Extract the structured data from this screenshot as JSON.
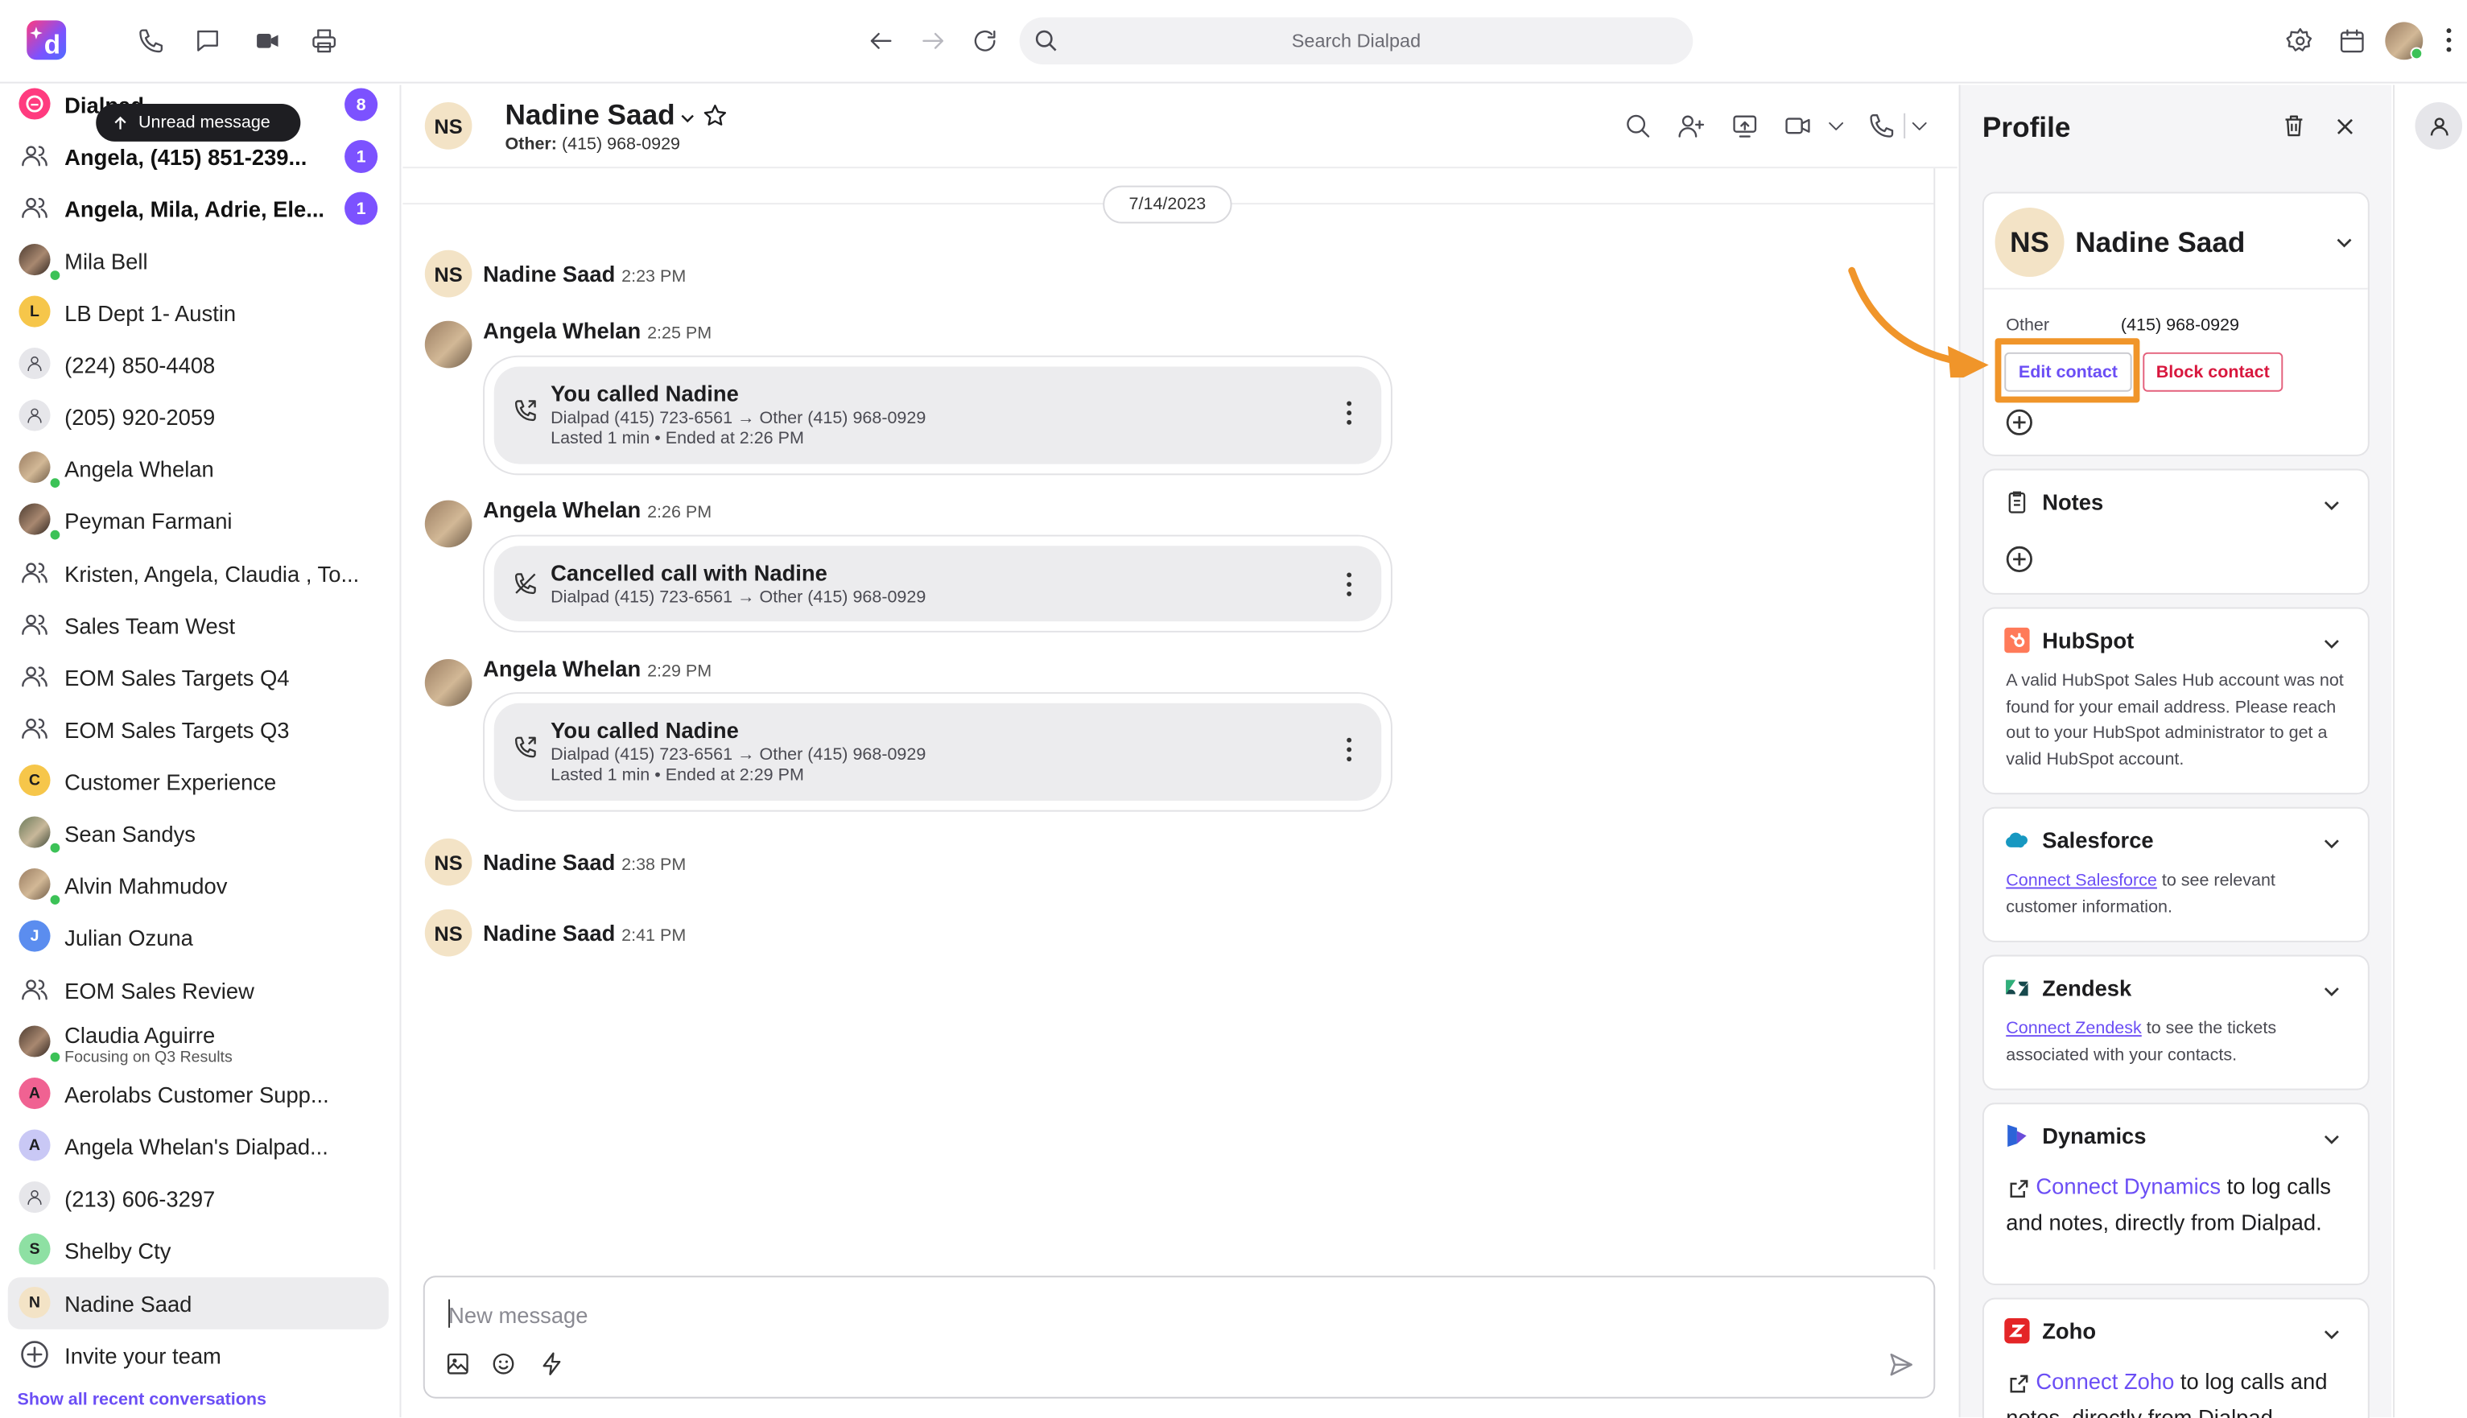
{
  "topbar": {
    "search_placeholder": "Search Dialpad"
  },
  "tooltip": {
    "text": "Unread message"
  },
  "sidebar": {
    "items": [
      {
        "label": "Dialpad",
        "badge": "8"
      },
      {
        "label": "Angela, (415) 851-239...",
        "badge": "1"
      },
      {
        "label": "Angela, Mila, Adrie, Ele...",
        "badge": "1"
      },
      {
        "label": "Mila Bell"
      },
      {
        "label": "LB Dept 1- Austin",
        "initial": "L"
      },
      {
        "label": "(224) 850-4408"
      },
      {
        "label": "(205) 920-2059"
      },
      {
        "label": "Angela Whelan"
      },
      {
        "label": "Peyman Farmani"
      },
      {
        "label": "Kristen, Angela, Claudia , To..."
      },
      {
        "label": "Sales Team West"
      },
      {
        "label": "EOM Sales Targets Q4"
      },
      {
        "label": "EOM Sales Targets Q3"
      },
      {
        "label": "Customer Experience",
        "initial": "C"
      },
      {
        "label": "Sean Sandys"
      },
      {
        "label": "Alvin Mahmudov"
      },
      {
        "label": "Julian Ozuna",
        "initial": "J"
      },
      {
        "label": "EOM Sales Review"
      },
      {
        "label": "Claudia Aguirre",
        "sub": "Focusing on Q3 Results"
      },
      {
        "label": "Aerolabs Customer Supp...",
        "initial": "A"
      },
      {
        "label": "Angela Whelan's Dialpad...",
        "initial": "A"
      },
      {
        "label": "(213) 606-3297"
      },
      {
        "label": "Shelby Cty",
        "initial": "S"
      },
      {
        "label": "Nadine Saad",
        "initial": "N"
      }
    ],
    "invite_label": "Invite your team",
    "show_all_label": "Show all recent conversations"
  },
  "chat": {
    "contact_name": "Nadine Saad",
    "contact_initials": "NS",
    "contact_sub_label": "Other:",
    "contact_sub_value": "(415) 968-0929",
    "date": "7/14/2023",
    "messages": [
      {
        "name": "Nadine Saad",
        "time": "2:23 PM"
      },
      {
        "name": "Angela Whelan",
        "time": "2:25 PM",
        "card_title": "You called Nadine",
        "card_line1": "Dialpad (415) 723-6561 → Other (415) 968-0929",
        "card_line2": "Lasted 1 min • Ended at 2:26 PM"
      },
      {
        "name": "Angela Whelan",
        "time": "2:26 PM",
        "card_title": "Cancelled call with Nadine",
        "card_line1": "Dialpad (415) 723-6561 → Other (415) 968-0929"
      },
      {
        "name": "Angela Whelan",
        "time": "2:29 PM",
        "card_title": "You called Nadine",
        "card_line1": "Dialpad (415) 723-6561 → Other (415) 968-0929",
        "card_line2": "Lasted 1 min • Ended at 2:29 PM"
      },
      {
        "name": "Nadine Saad",
        "time": "2:38 PM"
      },
      {
        "name": "Nadine Saad",
        "time": "2:41 PM"
      }
    ],
    "composer_placeholder": "New message"
  },
  "profile": {
    "title": "Profile",
    "contact_name": "Nadine Saad",
    "contact_initials": "NS",
    "phone_type": "Other",
    "phone_number": "(415) 968-0929",
    "edit_label": "Edit contact",
    "block_label": "Block contact",
    "notes_title": "Notes",
    "hubspot": {
      "title": "HubSpot",
      "body": "A valid HubSpot Sales Hub account was not found for your email address. Please reach out to your HubSpot administrator to get a valid HubSpot account."
    },
    "salesforce": {
      "title": "Salesforce",
      "link": "Connect Salesforce",
      "rest": " to see relevant customer information."
    },
    "zendesk": {
      "title": "Zendesk",
      "link": "Connect Zendesk",
      "rest": " to see the tickets associated with your contacts."
    },
    "dynamics": {
      "title": "Dynamics",
      "link": "Connect Dynamics",
      "rest": " to log calls and notes, directly from Dialpad."
    },
    "zoho": {
      "title": "Zoho",
      "link": "Connect Zoho",
      "rest": " to log calls and notes, directly from Dialpad."
    }
  },
  "colors": {
    "accent": "#7c52ff",
    "link": "#6b4ef5",
    "highlight": "#f0952a",
    "danger": "#d8173e"
  }
}
